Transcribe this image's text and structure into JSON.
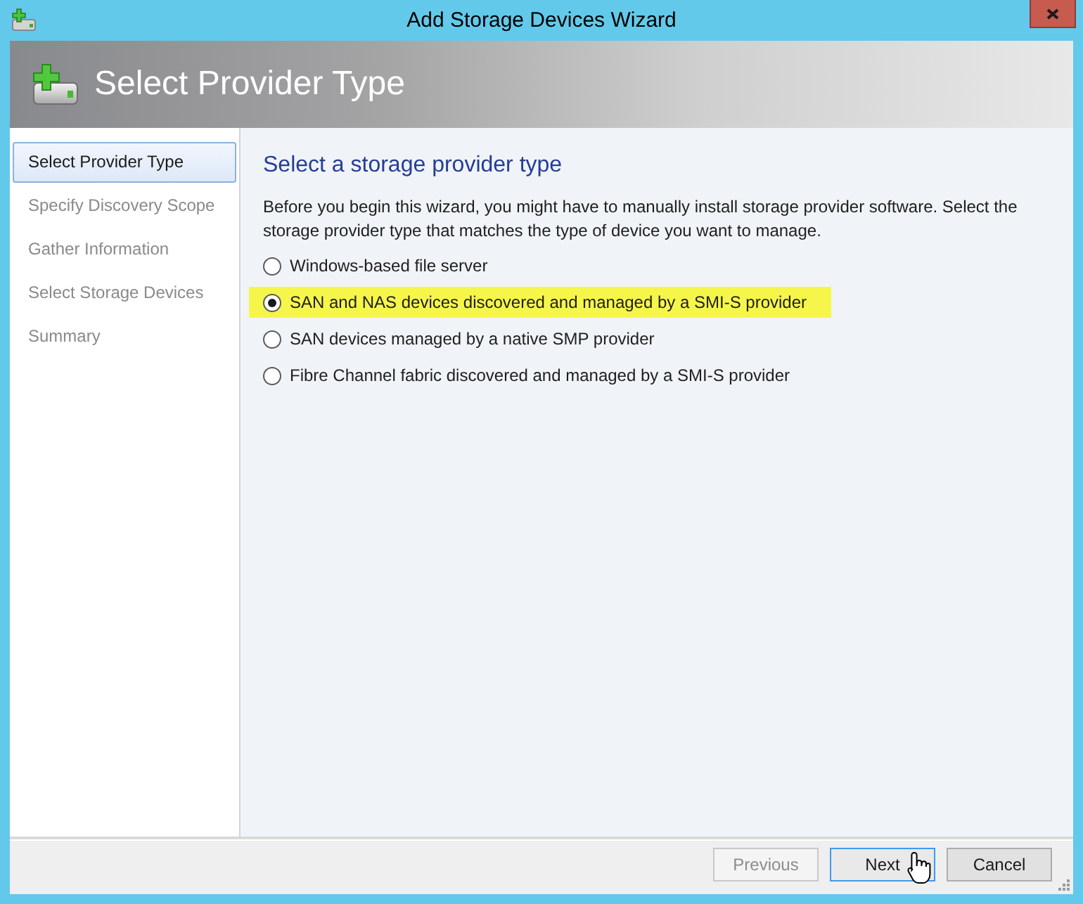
{
  "window": {
    "title": "Add Storage Devices Wizard"
  },
  "header": {
    "title": "Select Provider Type"
  },
  "steps": [
    {
      "label": "Select Provider Type",
      "selected": true
    },
    {
      "label": "Specify Discovery Scope",
      "selected": false
    },
    {
      "label": "Gather Information",
      "selected": false
    },
    {
      "label": "Select Storage Devices",
      "selected": false
    },
    {
      "label": "Summary",
      "selected": false
    }
  ],
  "content": {
    "heading": "Select a storage provider type",
    "description": "Before you begin this wizard, you might have to manually install storage provider software. Select the storage provider type that matches the type of device you want to manage.",
    "options": [
      {
        "label": "Windows-based file server",
        "selected": false,
        "highlighted": false
      },
      {
        "label": "SAN and NAS devices discovered and managed by a SMI-S provider",
        "selected": true,
        "highlighted": true
      },
      {
        "label": "SAN devices managed by a native SMP provider",
        "selected": false,
        "highlighted": false
      },
      {
        "label": "Fibre Channel fabric discovered and managed by a SMI-S provider",
        "selected": false,
        "highlighted": false
      }
    ]
  },
  "buttons": [
    {
      "label": "Previous",
      "disabled": true,
      "focused": false
    },
    {
      "label": "Next",
      "disabled": false,
      "focused": true
    },
    {
      "label": "Cancel",
      "disabled": false,
      "focused": false
    }
  ]
}
